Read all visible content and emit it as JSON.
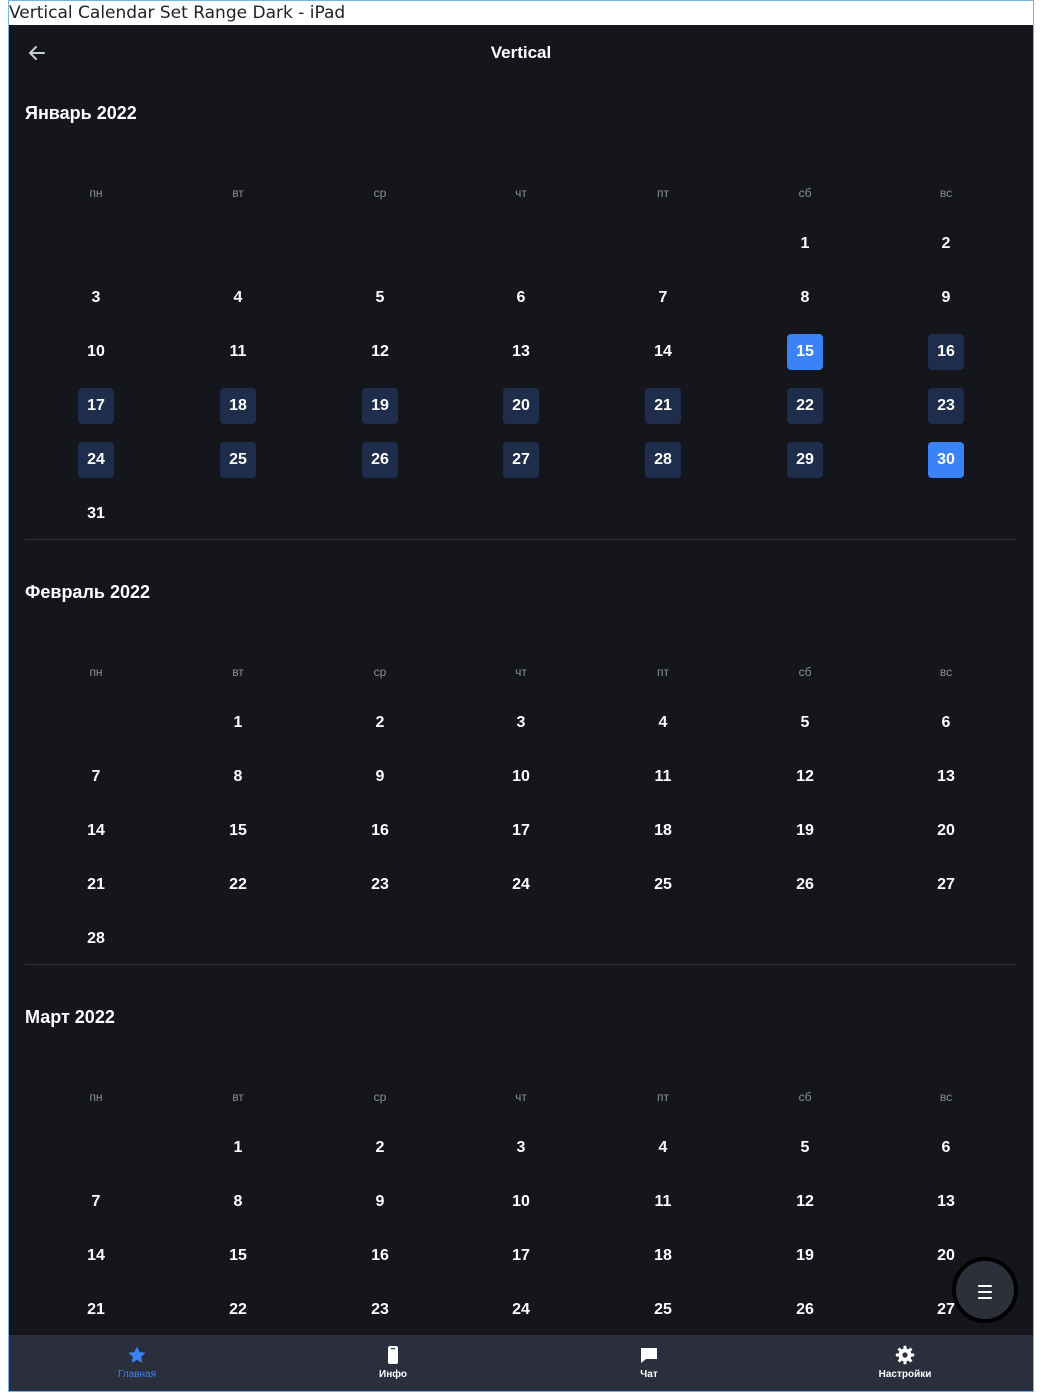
{
  "window": {
    "title": "Vertical Calendar Set Range Dark - iPad"
  },
  "header": {
    "title": "Vertical",
    "back_icon": "arrow-left-icon"
  },
  "weekdays": [
    "пн",
    "вт",
    "ср",
    "чт",
    "пт",
    "сб",
    "вс"
  ],
  "months": [
    {
      "title": "Январь 2022",
      "first_weekday_index": 5,
      "days_in_month": 31,
      "range_start": 15,
      "range_end": 30
    },
    {
      "title": "Февраль 2022",
      "first_weekday_index": 1,
      "days_in_month": 28
    },
    {
      "title": "Март 2022",
      "first_weekday_index": 1,
      "days_in_month": 31
    }
  ],
  "fab": {
    "icon": "menu-icon"
  },
  "tabbar": {
    "tabs": [
      {
        "label": "Главная",
        "icon": "star-icon",
        "active": true
      },
      {
        "label": "Инфо",
        "icon": "phone-icon",
        "active": false
      },
      {
        "label": "Чат",
        "icon": "chat-bubble-icon",
        "active": false
      },
      {
        "label": "Настройки",
        "icon": "gear-icon",
        "active": false
      }
    ]
  },
  "colors": {
    "background": "#14161c",
    "range_fill": "#1e2d4b",
    "range_edge": "#3b82f6",
    "tabbar": "#2b2f3d",
    "active_tab": "#3b82f6"
  }
}
